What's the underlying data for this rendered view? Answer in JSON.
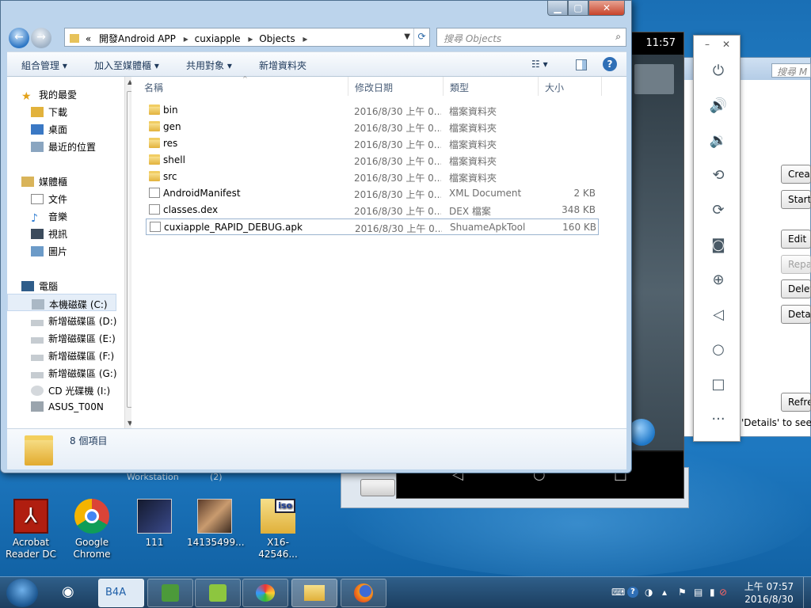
{
  "explorer": {
    "breadcrumb": [
      "«",
      "開發Android APP",
      "cuxiapple",
      "Objects"
    ],
    "search_placeholder": "搜尋 Objects",
    "commands": [
      "組合管理",
      "加入至媒體櫃",
      "共用對象",
      "新增資料夾"
    ],
    "columns": [
      "名稱",
      "修改日期",
      "類型",
      "大小"
    ],
    "nav": {
      "favorites": "我的最愛",
      "favorites_items": [
        "下載",
        "桌面",
        "最近的位置"
      ],
      "libraries": "媒體櫃",
      "libraries_items": [
        "文件",
        "音樂",
        "視訊",
        "圖片"
      ],
      "computer": "電腦",
      "drives": [
        "本機磁碟 (C:)",
        "新增磁碟區 (D:)",
        "新增磁碟區 (E:)",
        "新增磁碟區 (F:)",
        "新增磁碟區 (G:)",
        "CD 光碟機 (I:)",
        "ASUS_T00N"
      ]
    },
    "files": [
      {
        "name": "bin",
        "date": "2016/8/30 上午 0...",
        "type": "檔案資料夾",
        "size": "",
        "kind": "folder"
      },
      {
        "name": "gen",
        "date": "2016/8/30 上午 0...",
        "type": "檔案資料夾",
        "size": "",
        "kind": "folder"
      },
      {
        "name": "res",
        "date": "2016/8/30 上午 0...",
        "type": "檔案資料夾",
        "size": "",
        "kind": "folder"
      },
      {
        "name": "shell",
        "date": "2016/8/30 上午 0...",
        "type": "檔案資料夾",
        "size": "",
        "kind": "folder"
      },
      {
        "name": "src",
        "date": "2016/8/30 上午 0...",
        "type": "檔案資料夾",
        "size": "",
        "kind": "folder"
      },
      {
        "name": "AndroidManifest",
        "date": "2016/8/30 上午 0...",
        "type": "XML Document",
        "size": "2 KB",
        "kind": "xml"
      },
      {
        "name": "classes.dex",
        "date": "2016/8/30 上午 0...",
        "type": "DEX 檔案",
        "size": "348 KB",
        "kind": "file"
      },
      {
        "name": "cuxiapple_RAPID_DEBUG.apk",
        "date": "2016/8/30 上午 0...",
        "type": "ShuameApkTool",
        "size": "160 KB",
        "kind": "file"
      }
    ],
    "item_count": "8 個項目"
  },
  "emulator": {
    "clock": "11:57"
  },
  "background_window": {
    "search_text": "搜尋 M",
    "buttons": [
      "Creat",
      "Start",
      "Edit",
      "Repa",
      "Delet",
      "Detai",
      "Refre"
    ],
    "status_text": "'Details' to see t"
  },
  "desktop": {
    "labels_behind": [
      "Workstation",
      "(2)"
    ],
    "icons": [
      {
        "label": "Acrobat Reader DC"
      },
      {
        "label": "Google Chrome"
      },
      {
        "label": "111"
      },
      {
        "label": "14135499..."
      },
      {
        "label": "X16-42546..."
      }
    ]
  },
  "taskbar": {
    "pinned": [
      "B4A"
    ],
    "clock_time": "上午 07:57",
    "clock_date": "2016/8/30"
  },
  "colors": {
    "accent": "#1e395b",
    "selection_border": "#9ab3cf"
  }
}
